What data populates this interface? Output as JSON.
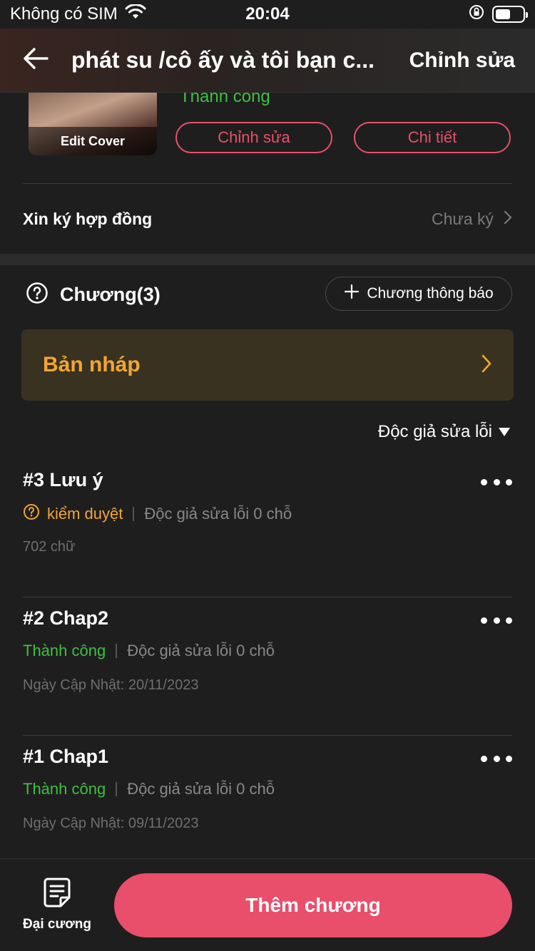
{
  "status_bar": {
    "carrier": "Không có SIM",
    "time": "20:04"
  },
  "nav": {
    "title": "phát su /cô ấy và tôi bạn c...",
    "edit_label": "Chỉnh sửa"
  },
  "book": {
    "cover_caption": "Edit Cover",
    "status": "Thành công",
    "edit_button": "Chỉnh sửa",
    "detail_button": "Chi tiết"
  },
  "contract": {
    "label": "Xin ký hợp đồng",
    "value": "Chưa ký"
  },
  "chapters": {
    "title": "Chương(3)",
    "notice_button": "Chương thông báo",
    "draft_label": "Bản nháp",
    "filter_label": "Độc giả sửa lỗi",
    "items": [
      {
        "title": "#3 Lưu ý",
        "status": "kiểm duyệt",
        "readers": "Độc giả sửa lỗi 0 chỗ",
        "footer": "702 chữ"
      },
      {
        "title": "#2 Chap2",
        "status": "Thành công",
        "readers": "Độc giả sửa lỗi 0 chỗ",
        "footer": "Ngày Cập Nhật: 20/11/2023"
      },
      {
        "title": "#1 Chap1",
        "status": "Thành công",
        "readers": "Độc giả sửa lỗi 0 chỗ",
        "footer": "Ngày Cập Nhật: 09/11/2023"
      }
    ]
  },
  "bottom": {
    "outline_label": "Đại cương",
    "add_button": "Thêm chương"
  },
  "colors": {
    "accent": "#e94e6a",
    "success": "#3ec03e",
    "warning": "#f2a634",
    "background": "#1e1e1f"
  },
  "icons": [
    "wifi-icon",
    "orientation-lock-icon",
    "battery-icon",
    "back-arrow-icon",
    "chevron-right-icon",
    "question-circle-icon",
    "plus-icon",
    "caret-down-icon",
    "more-dots-icon",
    "document-icon"
  ]
}
